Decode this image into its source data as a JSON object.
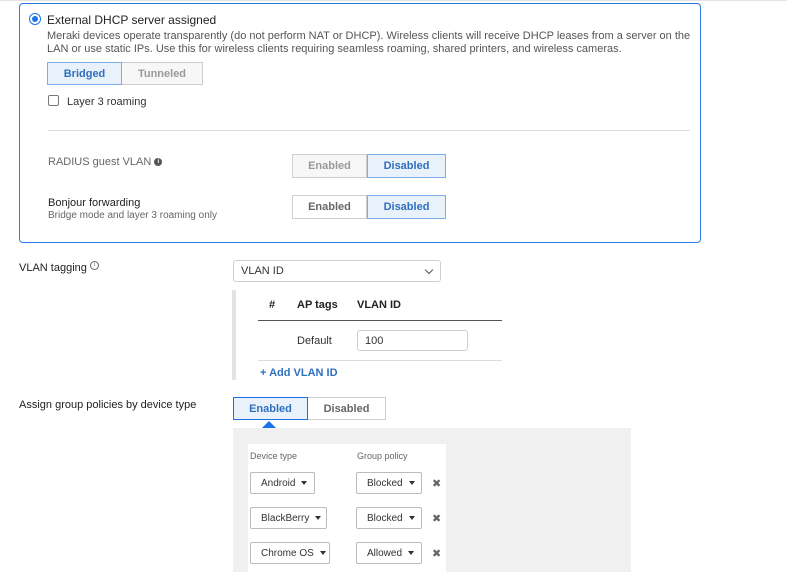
{
  "dhcp": {
    "option_title": "External DHCP server assigned",
    "description": "Meraki devices operate transparently (do not perform NAT or DHCP). Wireless clients will receive DHCP leases from a server on the LAN or use static IPs. Use this for wireless clients requiring seamless roaming, shared printers, and wireless cameras.",
    "mode_options": [
      "Bridged",
      "Tunneled"
    ],
    "mode_selected": "Bridged",
    "layer3_roaming_label": "Layer 3 roaming",
    "layer3_roaming_checked": false,
    "radius_guest_vlan": {
      "label": "RADIUS guest VLAN",
      "options": [
        "Enabled",
        "Disabled"
      ],
      "selected": "Disabled"
    },
    "bonjour": {
      "label": "Bonjour forwarding",
      "sublabel": "Bridge mode and layer 3 roaming only",
      "options": [
        "Enabled",
        "Disabled"
      ],
      "selected": "Disabled"
    }
  },
  "vlan_tagging": {
    "label": "VLAN tagging",
    "select_value": "VLAN ID",
    "table": {
      "headers": [
        "#",
        "AP tags",
        "VLAN ID"
      ],
      "rows": [
        {
          "ap_tags": "Default",
          "vlan_id": "100"
        }
      ]
    },
    "add_link": "+ Add VLAN ID"
  },
  "group_policies": {
    "label": "Assign group policies by device type",
    "options": [
      "Enabled",
      "Disabled"
    ],
    "selected": "Enabled",
    "col_device_type": "Device type",
    "col_group_policy": "Group policy",
    "rows": [
      {
        "device": "Android",
        "policy": "Blocked"
      },
      {
        "device": "BlackBerry",
        "policy": "Blocked"
      },
      {
        "device": "Chrome OS",
        "policy": "Allowed"
      }
    ],
    "remove_icon": "close-icon"
  },
  "colors": {
    "accent": "#1a73e8",
    "selected_bg": "#e9f1fb",
    "selected_text": "#2f6fbf"
  }
}
